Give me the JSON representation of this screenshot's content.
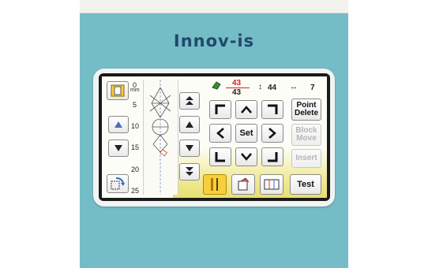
{
  "brand": {
    "logo_text": "Innov-is"
  },
  "ruler": {
    "unit": "mm",
    "ticks": [
      "0",
      "5",
      "10",
      "15",
      "20",
      "25"
    ]
  },
  "status": {
    "stitch_counter_current": "43",
    "stitch_counter_total": "43",
    "stitch_length_value": "44",
    "stitch_width_value": "7"
  },
  "buttons": {
    "point_delete_line1": "Point",
    "point_delete_line2": "Delete",
    "block_move_line1": "Block",
    "block_move_line2": "Move",
    "insert": "Insert",
    "set": "Set",
    "test": "Test"
  },
  "icons": {
    "nav_up_left": "corner-up-left-icon",
    "nav_up": "chevron-up-icon",
    "nav_up_right": "corner-up-right-icon",
    "nav_left": "chevron-left-icon",
    "nav_right": "chevron-right-icon",
    "nav_down_left": "corner-down-left-icon",
    "nav_down": "chevron-down-icon",
    "nav_down_right": "corner-down-right-icon"
  },
  "colors": {
    "machine_body": "#74bcc6",
    "brand_text": "#1f4a6b",
    "active_button": "#f7cf3d",
    "counter_red": "#d42020"
  }
}
